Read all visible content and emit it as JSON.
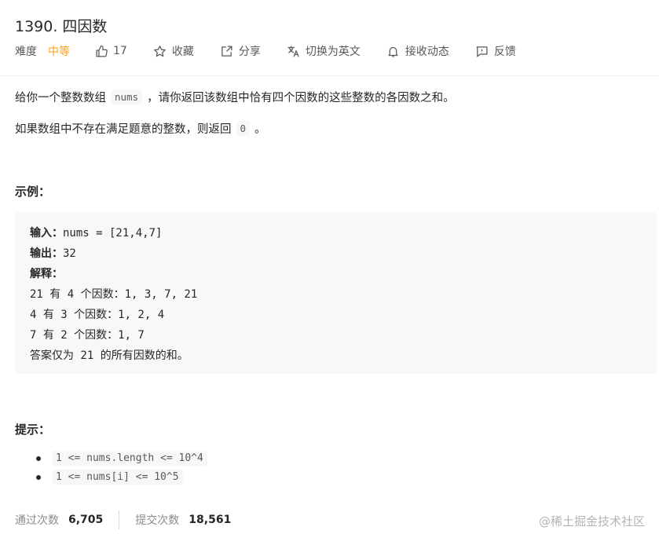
{
  "problem": {
    "title": "1390. 四因数",
    "difficulty_label": "难度",
    "difficulty_value": "中等",
    "likes": "17",
    "actions": {
      "collect": "收藏",
      "share": "分享",
      "switch_lang": "切换为英文",
      "subscribe": "接收动态",
      "feedback": "反馈"
    }
  },
  "description": {
    "line1_before": "给你一个整数数组",
    "line1_code": "nums",
    "line1_after": "，请你返回该数组中恰有四个因数的这些整数的各因数之和。",
    "line2_before": "如果数组中不存在满足题意的整数，则返回",
    "line2_code": "0",
    "line2_after": "。"
  },
  "example": {
    "heading": "示例：",
    "input_label": "输入：",
    "input_value": "nums = [21,4,7]",
    "output_label": "输出：",
    "output_value": "32",
    "explain_label": "解释：",
    "explain_lines": [
      "21 有 4 个因数：1, 3, 7, 21",
      "4 有 3 个因数：1, 2, 4",
      "7 有 2 个因数：1, 7",
      "答案仅为 21 的所有因数的和。"
    ]
  },
  "hints": {
    "heading": "提示：",
    "items": [
      "1 <= nums.length <= 10^4",
      "1 <= nums[i] <= 10^5"
    ]
  },
  "stats": {
    "accepted_label": "通过次数",
    "accepted_value": "6,705",
    "submitted_label": "提交次数",
    "submitted_value": "18,561"
  },
  "watermark": "@稀土掘金技术社区",
  "colors": {
    "accent_medium": "#ffa116",
    "text": "#262626",
    "muted": "#595959",
    "example_bg": "#f7f8fa"
  }
}
